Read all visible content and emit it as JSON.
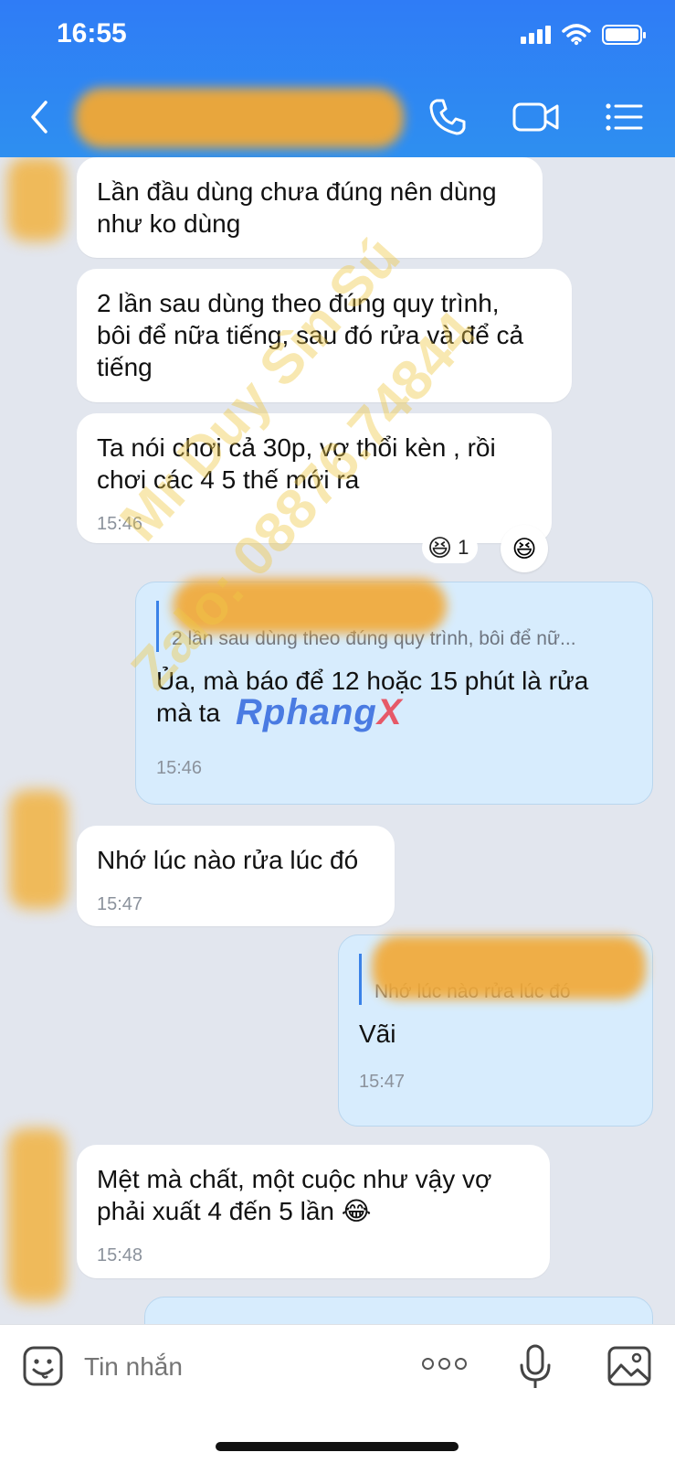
{
  "status_bar": {
    "time": "16:55"
  },
  "header": {
    "back_icon": "chevron-left-icon",
    "call_icon": "phone-icon",
    "video_icon": "video-camera-icon",
    "menu_icon": "list-menu-icon",
    "accent": "#2f7cf6"
  },
  "messages": [
    {
      "dir": "in",
      "text_lines": [
        "Lần đầu dùng chưa đúng nên dùng",
        "như ko dùng"
      ]
    },
    {
      "dir": "in",
      "text_lines": [
        "2 lần sau dùng theo đúng quy trình,",
        "bôi để nữa tiếng, sau đó rửa và để cả",
        "tiếng"
      ]
    },
    {
      "dir": "in",
      "text_lines": [
        "Ta nói chơi cả 30p, vợ thổi kèn , rồi",
        "chơi các 4 5 thế mới ra"
      ],
      "time": "15:46",
      "reaction_count": "1"
    },
    {
      "dir": "out",
      "quote": "2 lần sau dùng theo đúng quy trình, bôi để nữ...",
      "text_lines": [
        "Ủa, mà báo để 12 hoặc 15 phút là rửa",
        "mà ta"
      ],
      "time": "15:46"
    },
    {
      "dir": "in",
      "text_lines": [
        "Nhớ lúc nào rửa lúc đó"
      ],
      "time": "15:47"
    },
    {
      "dir": "out",
      "quote": "Nhớ lúc nào rửa lúc đó",
      "text_lines": [
        "Vãi"
      ],
      "time": "15:47"
    },
    {
      "dir": "in",
      "text_lines": [
        "Mệt mà chất, một cuộc như vậy vợ",
        "phải xuất 4 đến 5 lần"
      ],
      "emoji": "😂",
      "time": "15:48"
    }
  ],
  "watermark": {
    "line1": "Mr Duy Sìn Sú",
    "line2": "Zalo: 08876.74844",
    "logo_a": "Rphang",
    "logo_b": "X"
  },
  "composer": {
    "placeholder": "Tin nhắn",
    "emoji_icon": "sticker-face-icon",
    "more_icon": "more-dots-icon",
    "mic_icon": "microphone-icon",
    "image_icon": "image-icon"
  }
}
